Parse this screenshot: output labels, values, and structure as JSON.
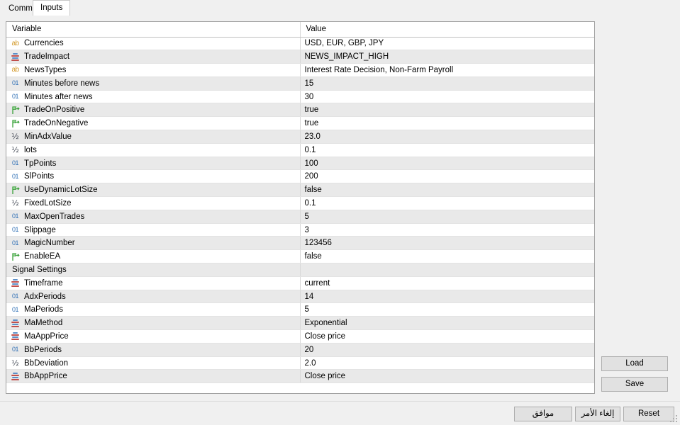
{
  "tabs": [
    {
      "label": "Common",
      "active": false
    },
    {
      "label": "Inputs",
      "active": true
    }
  ],
  "grid": {
    "columns": [
      "Variable",
      "Value"
    ],
    "rows": [
      {
        "icon": "string-icon",
        "variable": "Currencies",
        "value": "USD, EUR, GBP, JPY"
      },
      {
        "icon": "enum-icon",
        "variable": "TradeImpact",
        "value": "NEWS_IMPACT_HIGH"
      },
      {
        "icon": "string-icon",
        "variable": "NewsTypes",
        "value": "Interest Rate Decision, Non-Farm Payroll"
      },
      {
        "icon": "integer-icon",
        "variable": "Minutes before news",
        "value": "15"
      },
      {
        "icon": "integer-icon",
        "variable": "Minutes after news",
        "value": "30"
      },
      {
        "icon": "bool-icon",
        "variable": "TradeOnPositive",
        "value": "true"
      },
      {
        "icon": "bool-icon",
        "variable": "TradeOnNegative",
        "value": "true"
      },
      {
        "icon": "double-icon",
        "variable": "MinAdxValue",
        "value": "23.0"
      },
      {
        "icon": "double-icon",
        "variable": "lots",
        "value": "0.1"
      },
      {
        "icon": "integer-icon",
        "variable": "TpPoints",
        "value": "100"
      },
      {
        "icon": "integer-icon",
        "variable": "SlPoints",
        "value": "200"
      },
      {
        "icon": "bool-icon",
        "variable": "UseDynamicLotSize",
        "value": "false"
      },
      {
        "icon": "double-icon",
        "variable": "FixedLotSize",
        "value": "0.1"
      },
      {
        "icon": "integer-icon",
        "variable": "MaxOpenTrades",
        "value": "5"
      },
      {
        "icon": "integer-icon",
        "variable": "Slippage",
        "value": "3"
      },
      {
        "icon": "integer-icon",
        "variable": "MagicNumber",
        "value": "123456"
      },
      {
        "icon": "bool-icon",
        "variable": "EnableEA",
        "value": "false"
      },
      {
        "icon": "none",
        "variable": "Signal Settings",
        "value": "",
        "section": true
      },
      {
        "icon": "enum-icon",
        "variable": "Timeframe",
        "value": "current"
      },
      {
        "icon": "integer-icon",
        "variable": "AdxPeriods",
        "value": "14"
      },
      {
        "icon": "integer-icon",
        "variable": "MaPeriods",
        "value": "5"
      },
      {
        "icon": "enum-icon",
        "variable": "MaMethod",
        "value": "Exponential"
      },
      {
        "icon": "enum-icon",
        "variable": "MaAppPrice",
        "value": "Close price"
      },
      {
        "icon": "integer-icon",
        "variable": "BbPeriods",
        "value": "20"
      },
      {
        "icon": "double-icon",
        "variable": "BbDeviation",
        "value": "2.0"
      },
      {
        "icon": "enum-icon",
        "variable": "BbAppPrice",
        "value": "Close price"
      }
    ]
  },
  "side_buttons": {
    "load": "Load",
    "save": "Save"
  },
  "footer_buttons": {
    "ok": "موافق",
    "cancel": "إلغاء الأمر",
    "reset": "Reset"
  },
  "colors": {
    "string_icon": "#d39a2a",
    "integer_icon": "#2f6fb5",
    "bool_icon": "#3aa03a",
    "enum_bar_blue": "#5b8fc9",
    "enum_bar_red": "#c0504d",
    "row_alt": "#e9e9e9",
    "button_face": "#e1e1e1",
    "window_bg": "#f0f0f0"
  }
}
